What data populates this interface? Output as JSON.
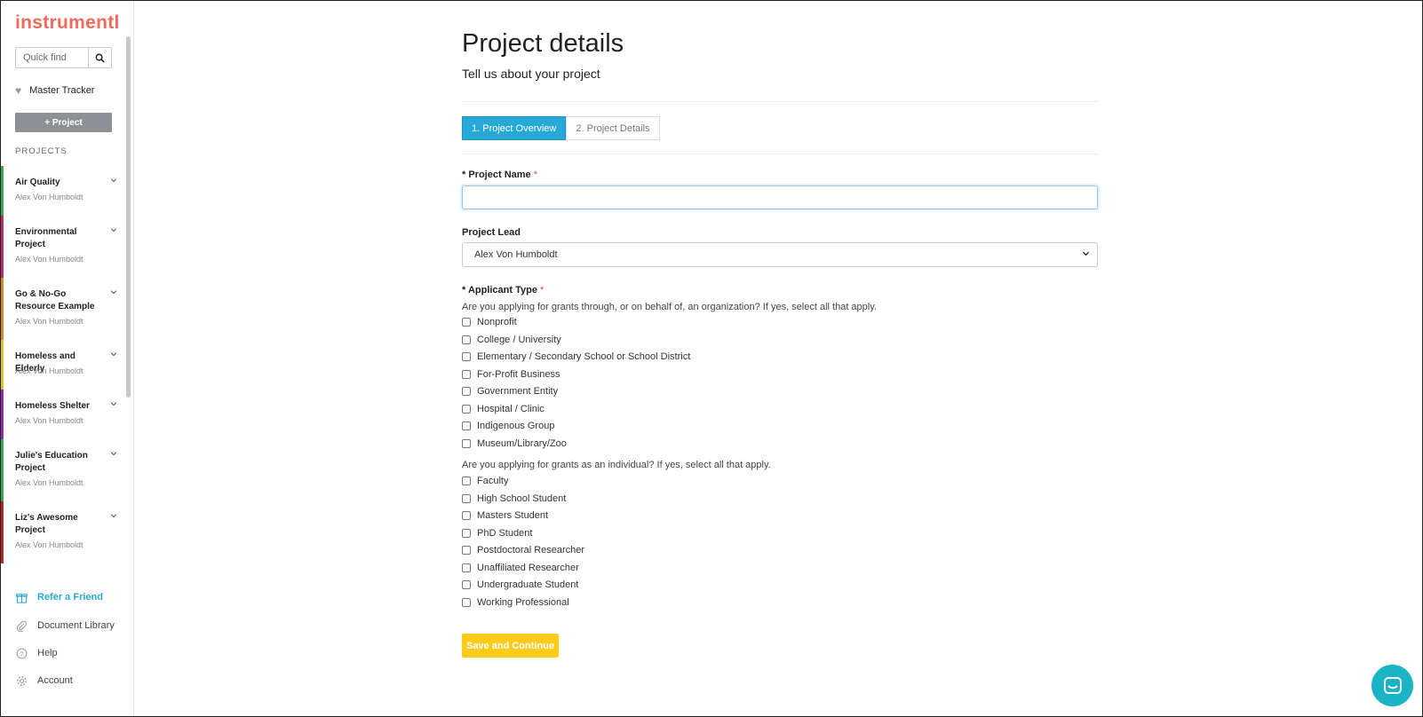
{
  "sidebar": {
    "logo": "instrumentl",
    "quickfind_placeholder": "Quick find",
    "master_tracker": "Master Tracker",
    "add_project": "+ Project",
    "projects_heading": "PROJECTS",
    "projects": [
      {
        "name": "Air Quality",
        "owner": "Alex Von Humboldt",
        "color": "#3aa655"
      },
      {
        "name": "Environmental Project",
        "owner": "Alex Von Humboldt",
        "color": "#b0306a"
      },
      {
        "name": "Go & No-Go Resource Example",
        "owner": "Alex Von Humboldt",
        "color": "#d08a2a"
      },
      {
        "name": "Homeless and Elderly",
        "owner": "Alex Von Humboldt",
        "color": "#d6c42a"
      },
      {
        "name": "Homeless Shelter",
        "owner": "Alex Von Humboldt",
        "color": "#8a2fa8"
      },
      {
        "name": "Julie's Education Project",
        "owner": "Alex Von Humboldt",
        "color": "#3aa655"
      },
      {
        "name": "Liz's Awesome Project",
        "owner": "Alex Von Humboldt",
        "color": "#b02a2a"
      }
    ],
    "bottom_links": [
      {
        "label": "Refer a Friend",
        "icon": "gift-icon"
      },
      {
        "label": "Document Library",
        "icon": "paperclip-icon"
      },
      {
        "label": "Help",
        "icon": "question-icon"
      },
      {
        "label": "Account",
        "icon": "gear-icon"
      }
    ]
  },
  "main": {
    "title": "Project details",
    "subtitle": "Tell us about your project",
    "steps": [
      "1. Project Overview",
      "2. Project Details"
    ],
    "project_name_label": "Project Name",
    "required_prefix": "*",
    "required_star": "*",
    "project_name_value": "",
    "project_lead_label": "Project Lead",
    "project_lead_value": "Alex Von Humboldt",
    "applicant_type_label": "Applicant Type",
    "org_help": "Are you applying for grants through, or on behalf of, an organization? If yes, select all that apply.",
    "org_options": [
      "Nonprofit",
      "College / University",
      "Elementary / Secondary School or School District",
      "For-Profit Business",
      "Government Entity",
      "Hospital / Clinic",
      "Indigenous Group",
      "Museum/Library/Zoo"
    ],
    "individual_help": "Are you applying for grants as an individual? If yes, select all that apply.",
    "individual_options": [
      "Faculty",
      "High School Student",
      "Masters Student",
      "PhD Student",
      "Postdoctoral Researcher",
      "Unaffiliated Researcher",
      "Undergraduate Student",
      "Working Professional"
    ],
    "save_button": "Save and Continue"
  },
  "colors": {
    "brand": "#ef6b5c",
    "step_active": "#27a9d8",
    "save": "#fccb1a",
    "chat": "#1bb3c6"
  }
}
